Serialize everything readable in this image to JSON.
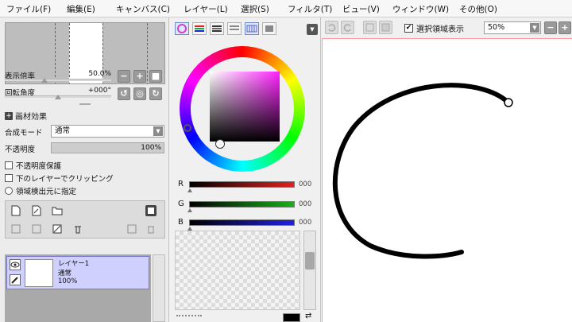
{
  "menu": {
    "file": "ファイル(F)",
    "edit": "編集(E)",
    "canvas": "キャンバス(C)",
    "layer": "レイヤー(L)",
    "select": "選択(S)",
    "filter": "フィルタ(T)",
    "view": "ビュー(V)",
    "window": "ウィンドウ(W)",
    "other": "その他(O)"
  },
  "navigator": {
    "zoom_label": "表示倍率",
    "zoom_value": "50.0%",
    "angle_label": "回転角度",
    "angle_value": "+000°"
  },
  "texture": {
    "title": "画材効果"
  },
  "layer_props": {
    "blend_label": "合成モード",
    "blend_value": "通常",
    "opacity_label": "不透明度",
    "opacity_value": "100%",
    "opacity_fraction": 1.0,
    "check_preserve": "不透明度保護",
    "check_clip": "下のレイヤーでクリッピング",
    "check_source": "領域検出元に指定"
  },
  "layers": [
    {
      "name": "レイヤー1",
      "mode": "通常",
      "opacity": "100%"
    }
  ],
  "color": {
    "r_label": "R",
    "g_label": "G",
    "b_label": "B",
    "r_value": "000",
    "g_value": "000",
    "b_value": "000",
    "r_color": "#e02020",
    "g_color": "#18b018",
    "b_color": "#2020e0"
  },
  "toolbar": {
    "selection_label": "選択領域表示",
    "selection_checked": true,
    "zoom_value": "50%"
  },
  "icons": [
    "minus-icon",
    "plus-icon",
    "fit-icon",
    "rotate-ccw-icon",
    "rotate-reset-icon",
    "rotate-cw-icon",
    "new-layer-icon",
    "new-linework-icon",
    "new-folder-icon",
    "undo-icon",
    "redo-icon",
    "eye-icon",
    "pen-icon"
  ],
  "colors": {
    "accent_layer": "#d0d0ff",
    "canvas_border": "#ff9aa8",
    "stroke": "#000000"
  }
}
